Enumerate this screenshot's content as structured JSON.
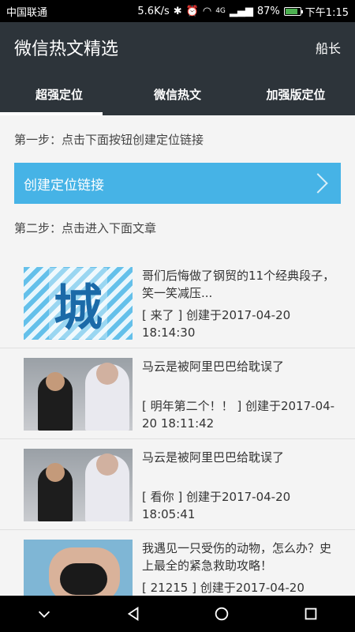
{
  "status": {
    "carrier": "中国联通",
    "speed": "5.6K/s",
    "battery_text": "87%",
    "battery_fraction": 0.87,
    "time": "下午1:15",
    "network": "4G"
  },
  "header": {
    "title": "微信热文精选",
    "action": "船长"
  },
  "tabs": [
    {
      "label": "超强定位",
      "active": true
    },
    {
      "label": "微信热文",
      "active": false
    },
    {
      "label": "加强版定位",
      "active": false
    }
  ],
  "steps": {
    "step1": "第一步：点击下面按钮创建定位链接",
    "create_button": "创建定位链接",
    "step2": "第二步：点击进入下面文章"
  },
  "articles": [
    {
      "title": "哥们后悔做了钢贸的11个经典段子， 笑一笑减压...",
      "date": "[ 来了 ] 创建于2017-04-20 18:14:30",
      "thumb_char": "城"
    },
    {
      "title": "马云是被阿里巴巴给耽误了",
      "date": "[ 明年第二个！！ ] 创建于2017-04-20 18:11:42"
    },
    {
      "title": "马云是被阿里巴巴给耽误了",
      "date": "[ 看你 ] 创建于2017-04-20 18:05:41"
    },
    {
      "title": "我遇见一只受伤的动物，怎么办？史上最全的紧急救助攻略！",
      "date": "[ 21215 ] 创建于2017-04-20"
    }
  ],
  "colors": {
    "header_bg": "#2d343a",
    "button_bg": "#46b3e6"
  }
}
